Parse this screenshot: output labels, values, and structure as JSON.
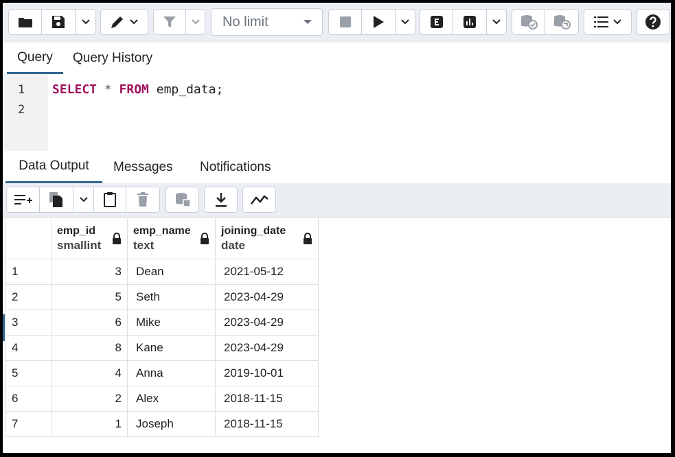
{
  "toolbar": {
    "limit_value": "No limit",
    "icons": [
      "folder-icon",
      "save-icon",
      "chevron-down-icon",
      "pencil-icon",
      "filter-icon",
      "stop-icon",
      "play-icon",
      "explain-icon",
      "analyze-icon",
      "commit-icon",
      "rollback-icon",
      "macros-icon",
      "help-icon"
    ]
  },
  "editor_tabs": [
    "Query",
    "Query History"
  ],
  "editor": {
    "line_numbers": [
      "1",
      "2"
    ],
    "line1": {
      "kw1": "SELECT",
      "star": " * ",
      "kw2": "FROM",
      "rest": " emp_data;"
    }
  },
  "output_tabs": [
    "Data Output",
    "Messages",
    "Notifications"
  ],
  "grid": {
    "columns": [
      {
        "name": "emp_id",
        "type": "smallint"
      },
      {
        "name": "emp_name",
        "type": "text"
      },
      {
        "name": "joining_date",
        "type": "date"
      }
    ],
    "rows": [
      {
        "n": "1",
        "id": "3",
        "name": "Dean",
        "date": "2021-05-12"
      },
      {
        "n": "2",
        "id": "5",
        "name": "Seth",
        "date": "2023-04-29"
      },
      {
        "n": "3",
        "id": "6",
        "name": "Mike",
        "date": "2023-04-29"
      },
      {
        "n": "4",
        "id": "8",
        "name": "Kane",
        "date": "2023-04-29"
      },
      {
        "n": "5",
        "id": "4",
        "name": "Anna",
        "date": "2019-10-01"
      },
      {
        "n": "6",
        "id": "2",
        "name": "Alex",
        "date": "2018-11-15"
      },
      {
        "n": "7",
        "id": "1",
        "name": "Joseph",
        "date": "2018-11-15"
      }
    ]
  },
  "colors": {
    "accent": "#326690",
    "keyword": "#a2135e"
  }
}
